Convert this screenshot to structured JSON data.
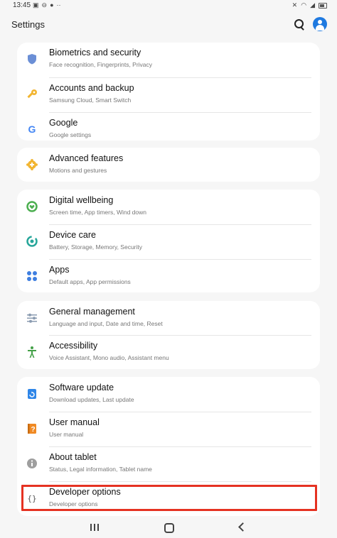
{
  "status_bar": {
    "time": "13:45",
    "left_icons": [
      "gallery-icon",
      "block-icon",
      "profile-icon",
      "more-icon"
    ],
    "right_icons": [
      "mute-icon",
      "wifi-icon",
      "signal-icon",
      "battery-icon"
    ]
  },
  "header": {
    "title": "Settings"
  },
  "groups": [
    {
      "items": [
        {
          "title": "Biometrics and security",
          "subtitle": "Face recognition, Fingerprints, Privacy",
          "icon": "shield-icon",
          "color": "#6b8fd6"
        },
        {
          "title": "Accounts and backup",
          "subtitle": "Samsung Cloud, Smart Switch",
          "icon": "key-icon",
          "color": "#f2b531"
        },
        {
          "title": "Google",
          "subtitle": "Google settings",
          "icon": "google-icon",
          "color": "#4285f4"
        }
      ]
    },
    {
      "items": [
        {
          "title": "Advanced features",
          "subtitle": "Motions and gestures",
          "icon": "gear-plus-icon",
          "color": "#f2b531"
        }
      ]
    },
    {
      "items": [
        {
          "title": "Digital wellbeing",
          "subtitle": "Screen time, App timers, Wind down",
          "icon": "wellbeing-icon",
          "color": "#4caf50"
        },
        {
          "title": "Device care",
          "subtitle": "Battery, Storage, Memory, Security",
          "icon": "device-care-icon",
          "color": "#26a69a"
        },
        {
          "title": "Apps",
          "subtitle": "Default apps, App permissions",
          "icon": "apps-grid-icon",
          "color": "#3f7fe0"
        }
      ]
    },
    {
      "items": [
        {
          "title": "General management",
          "subtitle": "Language and input, Date and time, Reset",
          "icon": "sliders-icon",
          "color": "#8a9bb0"
        },
        {
          "title": "Accessibility",
          "subtitle": "Voice Assistant, Mono audio, Assistant menu",
          "icon": "accessibility-icon",
          "color": "#43a047"
        }
      ]
    },
    {
      "items": [
        {
          "title": "Software update",
          "subtitle": "Download updates, Last update",
          "icon": "software-update-icon",
          "color": "#2f86e8"
        },
        {
          "title": "User manual",
          "subtitle": "User manual",
          "icon": "user-manual-icon",
          "color": "#f08a24"
        },
        {
          "title": "About tablet",
          "subtitle": "Status, Legal information, Tablet name",
          "icon": "info-icon",
          "color": "#9e9e9e"
        },
        {
          "title": "Developer options",
          "subtitle": "Developer options",
          "icon": "developer-braces-icon",
          "color": "#555555"
        }
      ]
    }
  ],
  "highlight_color": "#e53222",
  "nav": [
    "recents-icon",
    "home-icon",
    "back-icon"
  ]
}
